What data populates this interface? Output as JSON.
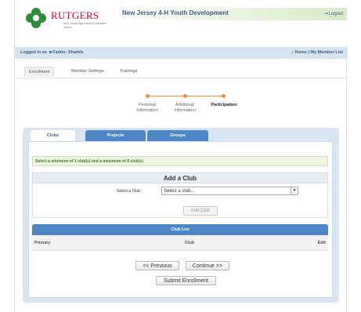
{
  "brand": {
    "name": "RUTGERS",
    "sub": "New Jersey Agricultural Experiment Station"
  },
  "header": {
    "site_title": "New Jersey 4-H Youth Development",
    "logout_label": "Logout"
  },
  "login_bar": {
    "logged_in_text": "Logged in as",
    "user_name": "Farkle: Sharkle",
    "home_link": "Home",
    "separator": "|",
    "member_list_link": "My Member List"
  },
  "top_tabs": [
    {
      "label": "Enrollment",
      "active": true
    },
    {
      "label": "Member Settings",
      "active": false
    },
    {
      "label": "Trainings",
      "active": false
    }
  ],
  "steps": [
    {
      "label_line1": "Personal",
      "label_line2": "Information"
    },
    {
      "label_line1": "Additional",
      "label_line2": "Information"
    },
    {
      "label_line1": "Participation",
      "label_line2": ""
    }
  ],
  "tabs": [
    {
      "label": "Clubs",
      "active": true
    },
    {
      "label": "Projects",
      "active": false
    },
    {
      "label": "Groups",
      "active": false
    }
  ],
  "notice": "Select a minimum of 1 club(s) and a maximum of 8 club(s)",
  "add_club": {
    "title": "Add a Club",
    "select_label": "Select a Club:",
    "select_value": "Select a club...",
    "add_button": "Add Club"
  },
  "club_list": {
    "title": "Club List",
    "columns": [
      "Primary",
      "Club",
      "Edit"
    ]
  },
  "buttons": {
    "previous": "<< Previous",
    "continue": "Continue >>",
    "submit": "Submit Enrollment"
  },
  "colors": {
    "accent_blue": "#4f86c5",
    "progress_orange": "#ef8f3f",
    "rutgers_red": "#cc0033",
    "clover_green": "#2f8a3a"
  },
  "icons": [
    "logout-icon",
    "user-icon",
    "home-icon",
    "chevron-down-icon",
    "clover-logo-icon"
  ]
}
